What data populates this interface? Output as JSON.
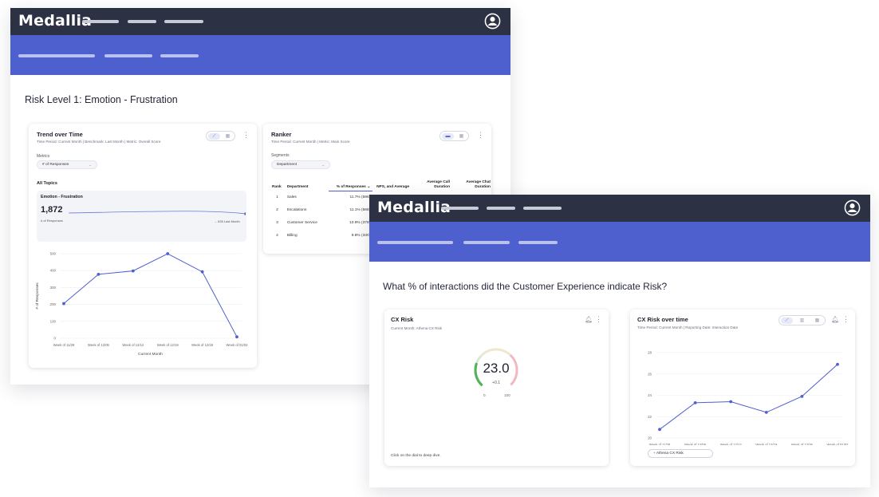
{
  "colors": {
    "topbar": "#2c3143",
    "band": "#4e5fce",
    "accent": "#4e5fce",
    "green": "#56b25a",
    "pink": "#f2b8c0"
  },
  "win1": {
    "logo": "Medallia",
    "page_title": "Risk Level 1: Emotion - Frustration",
    "trend": {
      "title": "Trend over Time",
      "subtitle": "Time Period: Current Month | Benchmark: Last Month | Metric: Overall Score",
      "metrics_label": "Metrics",
      "metric_value": "# of Responses",
      "all_topics": "All Topics",
      "topic": {
        "name": "Emotion - Frustration",
        "value": "1,872",
        "unit": "# of Responses",
        "delta": "835",
        "delta_label": "Last Month"
      },
      "icons": [
        "line-chart-icon",
        "table-icon",
        "more-icon"
      ]
    },
    "ranker": {
      "title": "Ranker",
      "subtitle": "Time Period: Current Month | Metric: Main Score",
      "segments_label": "Segments",
      "segment_value": "Department",
      "headers": [
        "Rank",
        "Department",
        "% of Responses",
        "NPS, and Average",
        "Average Call Duration",
        "Average Chat Duration"
      ],
      "rows": [
        {
          "rank": "1",
          "dept": "Sales",
          "pct": "11.7% (596)"
        },
        {
          "rank": "2",
          "dept": "Escalations",
          "pct": "11.1% (568)"
        },
        {
          "rank": "3",
          "dept": "Customer Service",
          "pct": "10.9% (378)"
        },
        {
          "rank": "4",
          "dept": "Billing",
          "pct": "9.8% (330)"
        }
      ]
    }
  },
  "win2": {
    "logo": "Medallia",
    "question": "What % of interactions did the Customer Experience indicate Risk?",
    "cxrisk": {
      "title": "CX Risk",
      "subtitle": "Current Month: Athena CX Risk",
      "value": "23.0",
      "delta": "+0.1",
      "min": "0",
      "max": "100",
      "gauge_level": 0.23,
      "footer": "Click on the dial to deep dive."
    },
    "cxtime": {
      "title": "CX Risk over time",
      "subtitle": "Time Period: Current Month | Reporting Date: Interaction Date",
      "legend": "Athena CX Risk"
    }
  },
  "chart_data": [
    {
      "type": "line",
      "title": "",
      "xlabel": "Current Month",
      "ylabel": "# of Responses",
      "categories": [
        "Week of 11/28",
        "Week of 12/05",
        "Week of 12/12",
        "Week of 12/19",
        "Week of 12/26",
        "Week of 01/02"
      ],
      "series": [
        {
          "values": [
            205,
            378,
            398,
            500,
            393,
            8
          ]
        }
      ],
      "ylim": [
        0,
        500
      ],
      "yticks": [
        "0",
        "100",
        "200",
        "300",
        "400",
        "500"
      ],
      "grid": true
    },
    {
      "type": "line",
      "title": "",
      "categories": [
        "Week of 11/28",
        "Week of 12/05",
        "Week of 12/12",
        "Week of 12/19",
        "Week of 12/26",
        "Week of 01/02"
      ],
      "series": [
        {
          "name": "Athena CX Risk",
          "values": [
            20.8,
            23.3,
            23.4,
            22.4,
            23.9,
            26.9
          ]
        }
      ],
      "ylim": [
        20,
        28
      ],
      "yticks": [
        "20",
        "22",
        "24",
        "26",
        "28"
      ],
      "grid": true
    }
  ]
}
